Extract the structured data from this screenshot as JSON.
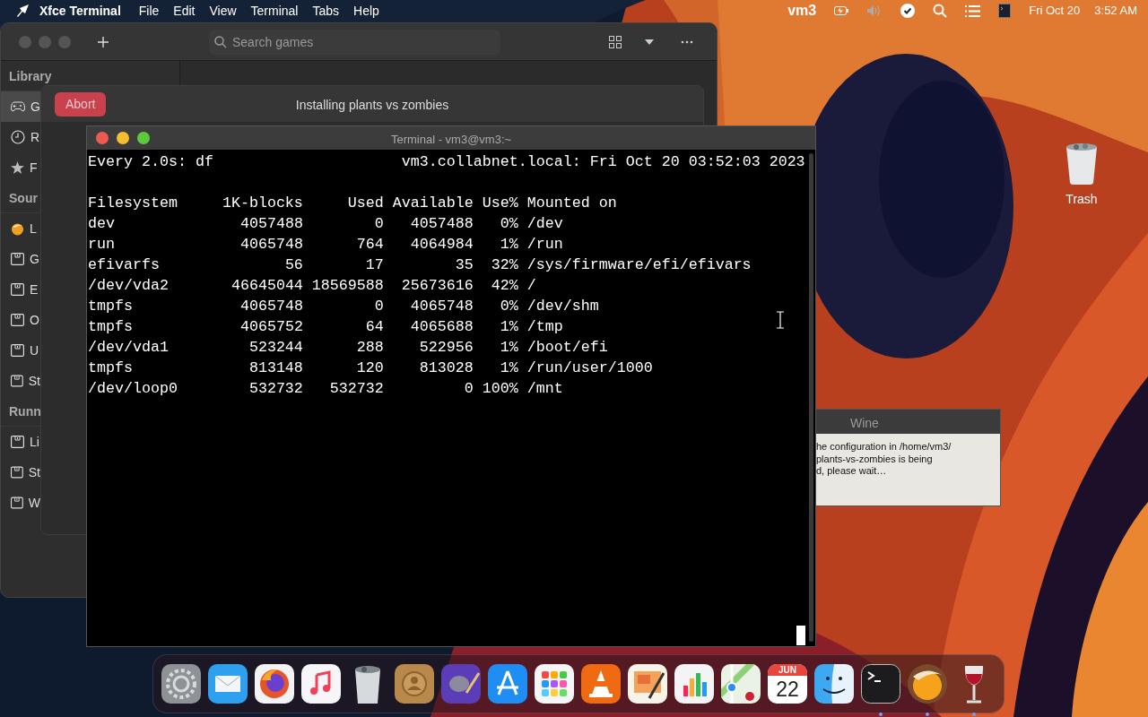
{
  "menubar": {
    "app_name": "Xfce Terminal",
    "menus": [
      "File",
      "Edit",
      "View",
      "Terminal",
      "Tabs",
      "Help"
    ],
    "user": "vm3",
    "date": "Fri Oct 20",
    "time": "3:52 AM"
  },
  "lutris": {
    "search": {
      "placeholder": "Search games"
    },
    "sidebar": [
      {
        "title": "Library",
        "items": [
          {
            "label": "G",
            "kind": "gamepad",
            "selected": true
          },
          {
            "label": "R",
            "kind": "clock",
            "selected": false
          },
          {
            "label": "F",
            "kind": "star",
            "selected": false
          }
        ]
      },
      {
        "title": "Sour",
        "items": [
          {
            "label": "L",
            "kind": "lutris",
            "selected": false
          },
          {
            "label": "G",
            "kind": "box",
            "selected": false
          },
          {
            "label": "E",
            "kind": "box",
            "selected": false
          },
          {
            "label": "O",
            "kind": "box",
            "selected": false
          },
          {
            "label": "U",
            "kind": "box",
            "selected": false
          },
          {
            "label": "St",
            "kind": "box",
            "selected": false
          }
        ]
      },
      {
        "title": "Runn",
        "items": [
          {
            "label": "Li",
            "kind": "box",
            "selected": false
          },
          {
            "label": "St",
            "kind": "box",
            "selected": false
          },
          {
            "label": "W",
            "kind": "box",
            "selected": false
          }
        ]
      }
    ]
  },
  "install_dialog": {
    "abort": "Abort",
    "title": "Installing plants vs zombies"
  },
  "terminal": {
    "title": "Terminal - vm3@vm3:~",
    "command": "Every 2.0s: df",
    "host_time": "vm3.collabnet.local: Fri Oct 20 03:52:03 2023",
    "columns": [
      "Filesystem",
      "1K-blocks",
      "Used",
      "Available",
      "Use%",
      "Mounted on"
    ],
    "rows": [
      [
        "dev",
        "4057488",
        "0",
        "4057488",
        "0%",
        "/dev"
      ],
      [
        "run",
        "4065748",
        "764",
        "4064984",
        "1%",
        "/run"
      ],
      [
        "efivarfs",
        "56",
        "17",
        "35",
        "32%",
        "/sys/firmware/efi/efivars"
      ],
      [
        "/dev/vda2",
        "46645044",
        "18569588",
        "25673616",
        "42%",
        "/"
      ],
      [
        "tmpfs",
        "4065748",
        "0",
        "4065748",
        "0%",
        "/dev/shm"
      ],
      [
        "tmpfs",
        "4065752",
        "64",
        "4065688",
        "1%",
        "/tmp"
      ],
      [
        "/dev/vda1",
        "523244",
        "288",
        "522956",
        "1%",
        "/boot/efi"
      ],
      [
        "tmpfs",
        "813148",
        "120",
        "813028",
        "1%",
        "/run/user/1000"
      ],
      [
        "/dev/loop0",
        "532732",
        "532732",
        "0",
        "100%",
        "/mnt"
      ]
    ]
  },
  "wine": {
    "title": "Wine",
    "lines": [
      "he configuration in /home/vm3/",
      "plants-vs-zombies is being",
      "d, please wait…"
    ]
  },
  "desktop_icons": [
    {
      "label": "Trash"
    }
  ],
  "dock": [
    {
      "kind": "settings",
      "running": false
    },
    {
      "kind": "mail",
      "running": false
    },
    {
      "kind": "browser",
      "running": false
    },
    {
      "kind": "music",
      "running": false
    },
    {
      "kind": "trash",
      "running": false
    },
    {
      "kind": "contacts",
      "running": false
    },
    {
      "kind": "paint",
      "running": false
    },
    {
      "kind": "appstore",
      "running": false
    },
    {
      "kind": "launchpad",
      "running": false
    },
    {
      "kind": "cone",
      "running": false
    },
    {
      "kind": "notes",
      "running": false
    },
    {
      "kind": "chart",
      "running": false
    },
    {
      "kind": "map",
      "running": false
    },
    {
      "kind": "calendar",
      "month": "JUN",
      "day": "22",
      "running": false
    },
    {
      "kind": "finder",
      "running": false
    },
    {
      "kind": "terminal",
      "running": true
    },
    {
      "kind": "lutris",
      "running": true
    },
    {
      "kind": "wine",
      "running": true
    }
  ]
}
